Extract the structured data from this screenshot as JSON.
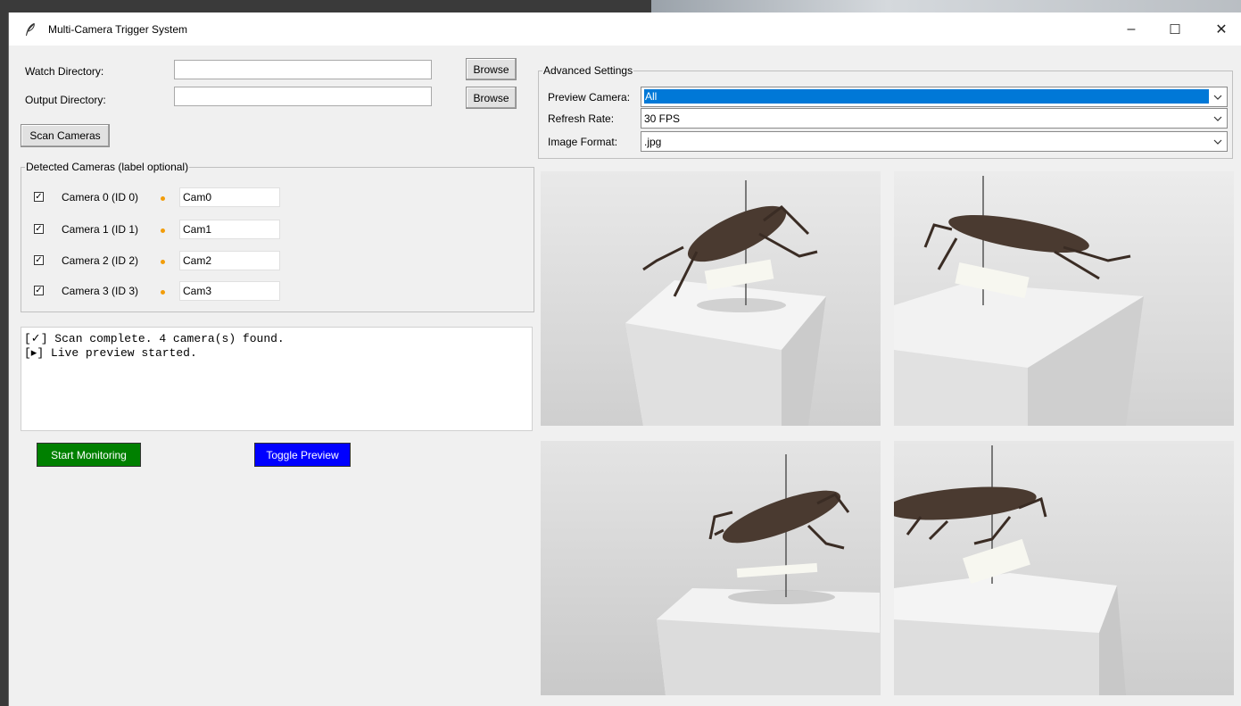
{
  "window": {
    "title": "Multi-Camera Trigger System"
  },
  "controls": {
    "minimize": "–",
    "maximize": "☐",
    "close": "✕"
  },
  "dirs": {
    "watch_label": "Watch Directory:",
    "watch_value": "",
    "output_label": "Output Directory:",
    "output_value": "",
    "browse_label": "Browse"
  },
  "scan_button": "Scan Cameras",
  "detected": {
    "legend": "Detected Cameras (label optional)",
    "cameras": [
      {
        "label": "Camera 0 (ID 0)",
        "name": "Cam0",
        "checked": "✓"
      },
      {
        "label": "Camera 1 (ID 1)",
        "name": "Cam1",
        "checked": "✓"
      },
      {
        "label": "Camera 2 (ID 2)",
        "name": "Cam2",
        "checked": "✓"
      },
      {
        "label": "Camera 3 (ID 3)",
        "name": "Cam3",
        "checked": "✓"
      }
    ],
    "status_color": "#f29d0a"
  },
  "log": {
    "lines": [
      "[✓] Scan complete. 4 camera(s) found.",
      "[▸] Live preview started."
    ]
  },
  "actions": {
    "start_label": "Start Monitoring",
    "start_color": "#008000",
    "toggle_label": "Toggle Preview",
    "toggle_color": "#0000ff"
  },
  "advanced": {
    "legend": "Advanced Settings",
    "preview_camera_label": "Preview Camera:",
    "preview_camera_value": "All",
    "refresh_rate_label": "Refresh Rate:",
    "refresh_rate_value": "30 FPS",
    "image_format_label": "Image Format:",
    "image_format_value": ".jpg"
  },
  "previews": [
    "camera-0-preview",
    "camera-1-preview",
    "camera-2-preview",
    "camera-3-preview"
  ],
  "accent_color": "#0078d7"
}
